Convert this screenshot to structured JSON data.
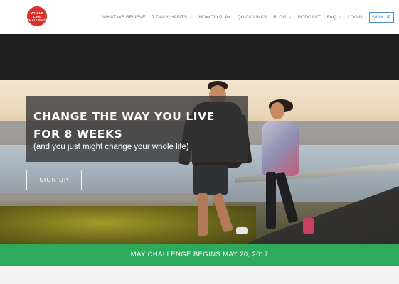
{
  "logo": {
    "line1": "WHOLE LIFE",
    "line2": "CHALLENGE"
  },
  "nav": {
    "items": [
      {
        "label": "WHAT WE BELIEVE",
        "has_caret": false
      },
      {
        "label": "7 DAILY HABITS",
        "has_caret": true
      },
      {
        "label": "HOW TO PLAY",
        "has_caret": false
      },
      {
        "label": "QUICK LINKS",
        "has_caret": false
      },
      {
        "label": "BLOG",
        "has_caret": true
      },
      {
        "label": "PODCAST",
        "has_caret": false
      },
      {
        "label": "FAQ",
        "has_caret": true
      },
      {
        "label": "LOGIN",
        "has_caret": false
      }
    ],
    "signup_label": "SIGN UP",
    "caret": "⌄",
    "search_icon": "search-icon"
  },
  "hero": {
    "title": "CHANGE THE WAY YOU LIVE FOR 8 WEEKS",
    "subtitle": "(and you just might change your whole life)",
    "signup_label": "SIGN UP"
  },
  "banner": {
    "text": "MAY CHALLENGE BEGINS MAY 20, 2017"
  },
  "colors": {
    "brand_red": "#d9312b",
    "banner_green": "#2eaa5c",
    "nav_signup_blue": "#4a90c2",
    "dark_band": "#1e1e1e"
  }
}
